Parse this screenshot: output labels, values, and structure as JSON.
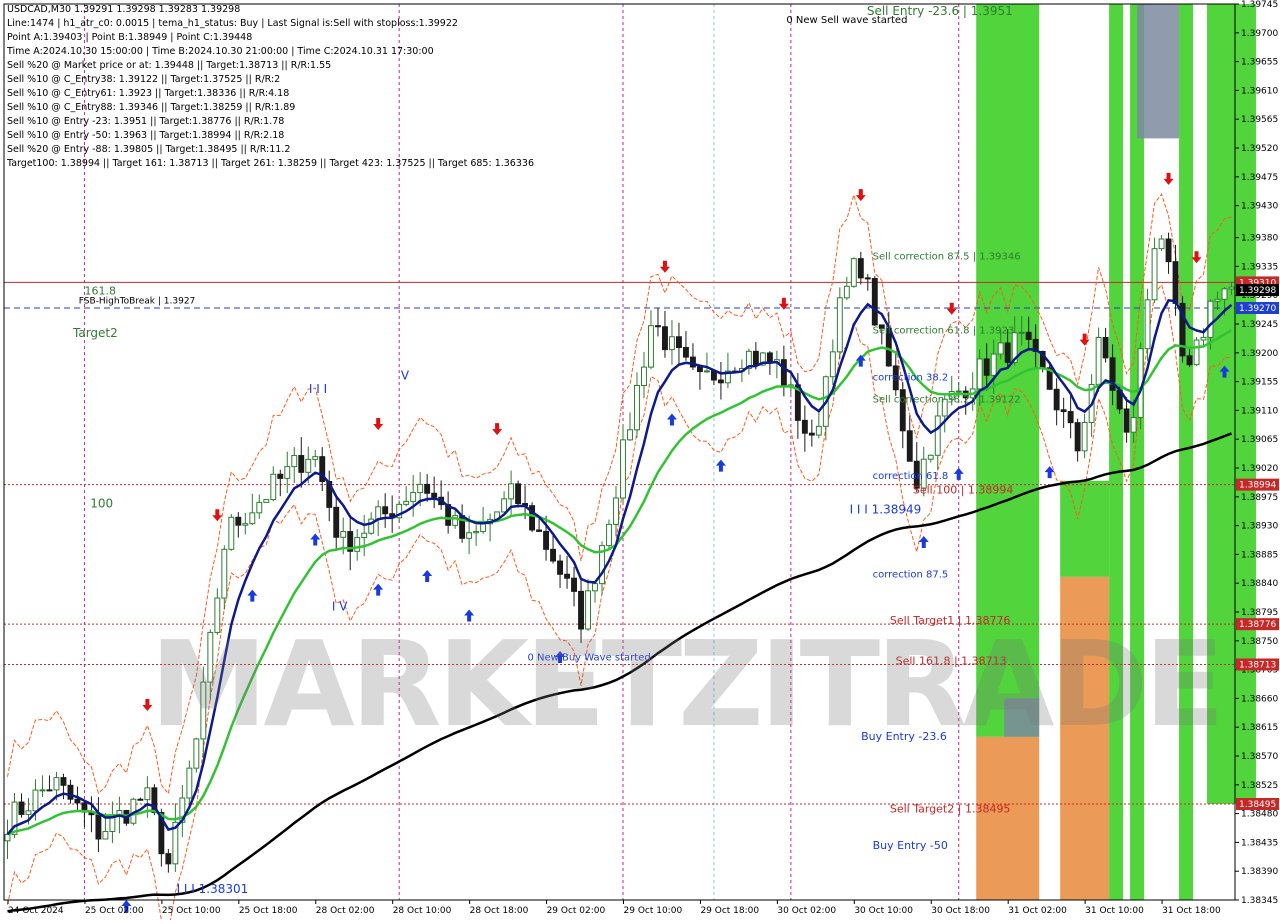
{
  "header": {
    "symbol_line": "USDCAD,M30  1.39291 1.39298 1.39283 1.39298",
    "info_lines": [
      "Line:1474 | h1_atr_c0: 0.0015 | tema_h1_status: Buy | Last Signal is:Sell with stoploss:1.39922",
      "Point A:1.39403 | Point B:1.38949 | Point C:1.39448",
      "Time A:2024.10.30 15:00:00 | Time B:2024.10.30 21:00:00 | Time C:2024.10.31 17:30:00",
      "Sell %20 @ Market price or at: 1.39448 || Target:1.38713 || R/R:1.55",
      "Sell %10 @ C_Entry38: 1.39122 || Target:1.37525 || R/R:2",
      "Sell %10 @ C_Entry61: 1.3923 || Target:1.38336 || R/R:4.18",
      "Sell %10 @ C_Entry88: 1.39346 || Target:1.38259 || R/R:1.89",
      "Sell %10 @ Entry -23: 1.3951 || Target:1.38776 || R/R:1.78",
      "Sell %10 @ Entry -50: 1.3963 || Target:1.38994 || R/R:2.18",
      "Sell %20 @ Entry -88: 1.39805 || Target:1.38495 || R/R:11.2",
      "Target100: 1.38994 || Target 161: 1.38713 || Target 261: 1.38259 || Target 423: 1.37525 || Target 685: 1.36336"
    ]
  },
  "watermark": "MARKETZITRADE",
  "colors": {
    "bull_candle": "#2e7d32",
    "bear_candle": "#1b1b1b",
    "ema_fast": "#0d1a8a",
    "ema_mid": "#33c233",
    "ema_slow": "#000000",
    "envelope": "#ff5a1a",
    "level_red": "#c62828",
    "level_blue": "#1e3fd0",
    "zone_green": "#33cc1a",
    "zone_orange": "#e88a3a",
    "zone_gray": "#7d8aa0",
    "arrow_up": "#1a3adf",
    "arrow_down": "#e01010"
  },
  "chart_data": {
    "type": "candlestick",
    "symbol": "USDCAD",
    "timeframe": "M30",
    "ylim": [
      1.38345,
      1.39745
    ],
    "y_ticks": [
      "1.39745",
      "1.39700",
      "1.39655",
      "1.39610",
      "1.39565",
      "1.39520",
      "1.39475",
      "1.39430",
      "1.39380",
      "1.39335",
      "1.39290",
      "1.39245",
      "1.39200",
      "1.39155",
      "1.39110",
      "1.39065",
      "1.39020",
      "1.38975",
      "1.38930",
      "1.38885",
      "1.38840",
      "1.38795",
      "1.38750",
      "1.38705",
      "1.38660",
      "1.38615",
      "1.38570",
      "1.38525",
      "1.38480",
      "1.38435",
      "1.38390",
      "1.38345"
    ],
    "x_ticks": [
      "24 Oct 2024",
      "25 Oct 02:00",
      "25 Oct 10:00",
      "25 Oct 18:00",
      "28 Oct 02:00",
      "28 Oct 10:00",
      "28 Oct 18:00",
      "29 Oct 02:00",
      "29 Oct 10:00",
      "29 Oct 18:00",
      "30 Oct 02:00",
      "30 Oct 10:00",
      "30 Oct 18:00",
      "31 Oct 02:00",
      "31 Oct 10:00",
      "31 Oct 18:00"
    ],
    "price_tags": [
      {
        "label": "1.39310",
        "value": 1.3931,
        "color": "#c62828"
      },
      {
        "label": "1.39298",
        "value": 1.39298,
        "color": "#000000"
      },
      {
        "label": "1.39270",
        "value": 1.3927,
        "color": "#1e3fd0"
      },
      {
        "label": "1.38994",
        "value": 1.38994,
        "color": "#c62828"
      },
      {
        "label": "1.38776",
        "value": 1.38776,
        "color": "#c62828"
      },
      {
        "label": "1.38713",
        "value": 1.38713,
        "color": "#c62828"
      },
      {
        "label": "1.38495",
        "value": 1.38495,
        "color": "#c62828"
      }
    ],
    "levels": [
      {
        "value": 1.3931,
        "color": "#c62828",
        "style": "solid"
      },
      {
        "value": 1.3927,
        "color": "#1e3fd0",
        "style": "dashed"
      },
      {
        "value": 1.38994,
        "color": "#c62828",
        "style": "dotted"
      },
      {
        "value": 1.38776,
        "color": "#c62828",
        "style": "dotted"
      },
      {
        "value": 1.38713,
        "color": "#c62828",
        "style": "dotted"
      },
      {
        "value": 1.38495,
        "color": "#c62828",
        "style": "dotted"
      }
    ],
    "annotations": [
      {
        "text": "Sell Entry -23.6 | 1.3951",
        "value": 1.39728,
        "bar": 150,
        "color": "#2e7d32",
        "size": 12
      },
      {
        "text": "0 New Sell wave started",
        "value": 1.39715,
        "bar": 136,
        "color": "#000000",
        "size": 10
      },
      {
        "text": "Sell correction 87.5 | 1.39346",
        "value": 1.39346,
        "bar": 151,
        "color": "#2e7d32",
        "size": 10
      },
      {
        "text": "Sell correction 61.8 | 1.3923",
        "value": 1.3923,
        "bar": 151,
        "color": "#2e7d32",
        "size": 10
      },
      {
        "text": "correction 38.2",
        "value": 1.39157,
        "bar": 151,
        "color": "#1a3adf",
        "size": 10
      },
      {
        "text": "Sell correction 38.2 | 1.39122",
        "value": 1.39122,
        "bar": 151,
        "color": "#2e7d32",
        "size": 10
      },
      {
        "text": "correction 61.8",
        "value": 1.39003,
        "bar": 151,
        "color": "#1a3adf",
        "size": 10
      },
      {
        "text": "Sell 100 | 1.38994",
        "value": 1.3898,
        "bar": 158,
        "color": "#c62828",
        "size": 11
      },
      {
        "text": "I I I  1.38949",
        "value": 1.38949,
        "bar": 147,
        "color": "#1a3adf",
        "size": 12
      },
      {
        "text": "correction 87.5",
        "value": 1.38849,
        "bar": 151,
        "color": "#1a3adf",
        "size": 10
      },
      {
        "text": "Sell Target1 | 1.38776",
        "value": 1.38776,
        "bar": 154,
        "color": "#c62828",
        "size": 11
      },
      {
        "text": "Sell 161.8 | 1.38713",
        "value": 1.38713,
        "bar": 155,
        "color": "#c62828",
        "size": 11
      },
      {
        "text": "Buy Entry -23.6",
        "value": 1.38595,
        "bar": 149,
        "color": "#1a3adf",
        "size": 11
      },
      {
        "text": "Sell Target2 | 1.38495",
        "value": 1.38482,
        "bar": 154,
        "color": "#c62828",
        "size": 11
      },
      {
        "text": "Buy Entry -50",
        "value": 1.38425,
        "bar": 151,
        "color": "#1a3adf",
        "size": 11
      },
      {
        "text": "0 New Buy Wave started",
        "value": 1.38719,
        "bar": 91,
        "color": "#1a3adf",
        "size": 10
      },
      {
        "text": "FSB-HighToBreak | 1.3927",
        "value": 1.39277,
        "bar": 13,
        "color": "#000000",
        "size": 9
      },
      {
        "text": "161.8",
        "value": 1.39291,
        "bar": 14,
        "color": "#2e7d32",
        "size": 11
      },
      {
        "text": "Target2",
        "value": 1.39225,
        "bar": 12,
        "color": "#2e7d32",
        "size": 12
      },
      {
        "text": "100",
        "value": 1.38958,
        "bar": 15,
        "color": "#2e7d32",
        "size": 12
      },
      {
        "text": "I I I",
        "value": 1.39137,
        "bar": 53,
        "color": "#1a3adf",
        "size": 12
      },
      {
        "text": "V",
        "value": 1.39158,
        "bar": 69,
        "color": "#1a3adf",
        "size": 12
      },
      {
        "text": "I V",
        "value": 1.38797,
        "bar": 57,
        "color": "#1a3adf",
        "size": 12
      },
      {
        "text": "I I I  1.38301",
        "value": 1.38356,
        "bar": 30,
        "color": "#1a3adf",
        "size": 12
      }
    ],
    "ema_fast_label": "",
    "bars": 176
  }
}
